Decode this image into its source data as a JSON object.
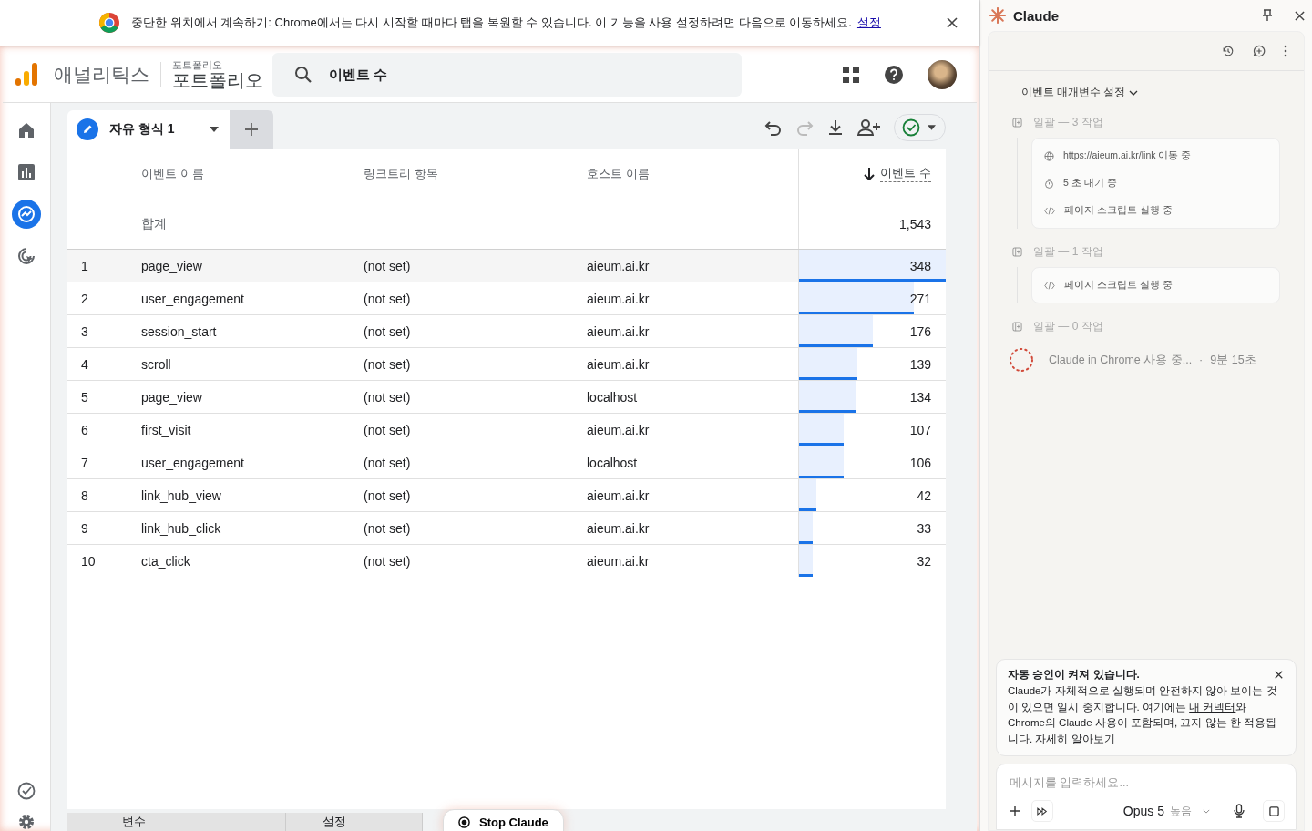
{
  "banner": {
    "text": "중단한 위치에서 계속하기: Chrome에서는 다시 시작할 때마다 탭을 복원할 수 있습니다. 이 기능을 사용 설정하려면 다음으로 이동하세요.",
    "link": "설정"
  },
  "header": {
    "product": "애널리틱스",
    "account": "포트폴리오",
    "property": "포트폴리오",
    "search": "이벤트 수"
  },
  "nav": [
    {
      "kind": "home",
      "selected": false
    },
    {
      "kind": "reports",
      "selected": false
    },
    {
      "kind": "explore",
      "selected": true
    },
    {
      "kind": "advertising",
      "selected": false
    }
  ],
  "tab": {
    "label": "자유 형식 1"
  },
  "table": {
    "columns": [
      "이벤트 이름",
      "링크트리 항목",
      "호스트 이름",
      "이벤트 수"
    ],
    "total_label": "합계",
    "total": "1,543",
    "rows": [
      {
        "index": "1",
        "event": "page_view",
        "item": "(not set)",
        "host": "aieum.ai.kr",
        "count": "348",
        "level": 1
      },
      {
        "index": "2",
        "event": "user_engagement",
        "item": "(not set)",
        "host": "aieum.ai.kr",
        "count": "271",
        "level": 0.78
      },
      {
        "index": "3",
        "event": "session_start",
        "item": "(not set)",
        "host": "aieum.ai.kr",
        "count": "176",
        "level": 0.506
      },
      {
        "index": "4",
        "event": "scroll",
        "item": "(not set)",
        "host": "aieum.ai.kr",
        "count": "139",
        "level": 0.4
      },
      {
        "index": "5",
        "event": "page_view",
        "item": "(not set)",
        "host": "localhost",
        "count": "134",
        "level": 0.385
      },
      {
        "index": "6",
        "event": "first_visit",
        "item": "(not set)",
        "host": "aieum.ai.kr",
        "count": "107",
        "level": 0.307
      },
      {
        "index": "7",
        "event": "user_engagement",
        "item": "(not set)",
        "host": "localhost",
        "count": "106",
        "level": 0.305
      },
      {
        "index": "8",
        "event": "link_hub_view",
        "item": "(not set)",
        "host": "aieum.ai.kr",
        "count": "42",
        "level": 0.12
      },
      {
        "index": "9",
        "event": "link_hub_click",
        "item": "(not set)",
        "host": "aieum.ai.kr",
        "count": "33",
        "level": 0.095
      },
      {
        "index": "10",
        "event": "cta_click",
        "item": "(not set)",
        "host": "aieum.ai.kr",
        "count": "32",
        "level": 0.092
      }
    ]
  },
  "bottom_tabs": [
    "변수",
    "설정"
  ],
  "stop_button": "Stop Claude",
  "claude": {
    "title": "Claude",
    "section": "이벤트 매개변수 설정",
    "batches": [
      {
        "title": "일괄 — 3 작업",
        "steps": [
          {
            "kind": "navigate",
            "text": "https://aieum.ai.kr/link 이동 중"
          },
          {
            "kind": "wait",
            "text": "5 초 대기 중"
          },
          {
            "kind": "script",
            "text": "페이지 스크립트 실행 중"
          }
        ]
      },
      {
        "title": "일괄 — 1 작업",
        "steps": [
          {
            "kind": "script",
            "text": "페이지 스크립트 실행 중"
          }
        ]
      },
      {
        "title": "일괄 — 0 작업"
      }
    ],
    "status": "Claude in Chrome 사용 중...",
    "separator": "·",
    "elapsed": "9분 15초",
    "notice": {
      "title": "자동 승인이 켜져 있습니다.",
      "parts": [
        {
          "kind": "text",
          "text": "Claude가 자체적으로 실행되며 안전하지 않아 보이는 것이 있으면 일시 중지합니다. 여기에는 "
        },
        {
          "kind": "link",
          "text": "내 커넥터"
        },
        {
          "kind": "text",
          "text": "와 Chrome의 Claude 사용이 포함되며, 끄지 않는 한 적용됩니다. "
        },
        {
          "kind": "link",
          "text": "자세히 알아보기"
        }
      ]
    },
    "input": {
      "placeholder": "메시지를 입력하세요..."
    },
    "model": "Opus 5",
    "effort": "높음"
  }
}
